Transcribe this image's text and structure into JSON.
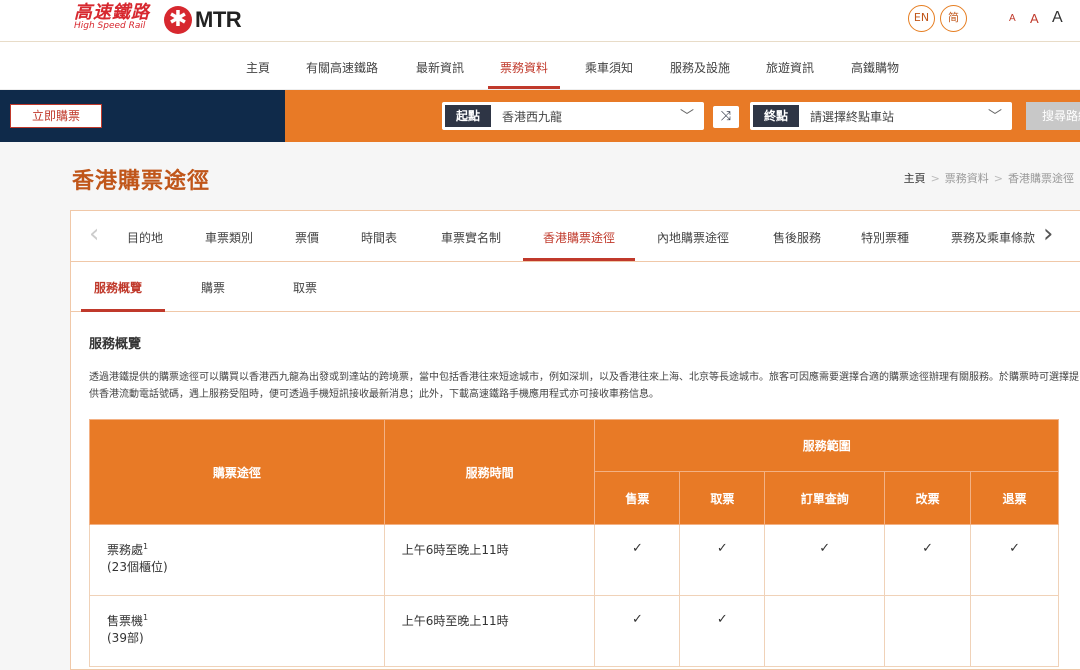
{
  "header": {
    "brand_zh": "高速鐵路",
    "brand_en": "High Speed Rail",
    "mtr_label": "MTR",
    "lang_en": "EN",
    "lang_sc": "简",
    "font_small": "A",
    "font_medium": "A",
    "font_large": "A"
  },
  "nav": {
    "items": [
      "主頁",
      "有關高速鐵路",
      "最新資訊",
      "票務資料",
      "乘車須知",
      "服務及設施",
      "旅遊資訊",
      "高鐵購物"
    ],
    "active_index": 3
  },
  "booking": {
    "buy_label": "立即購票",
    "origin_tag": "起點",
    "origin_value": "香港西九龍",
    "dest_tag": "終點",
    "dest_placeholder": "請選擇終點車站",
    "search_label": "搜尋路線"
  },
  "page": {
    "title": "香港購票途徑",
    "breadcrumb": [
      "主頁",
      "票務資料",
      "香港購票途徑"
    ]
  },
  "tabs": {
    "items": [
      "目的地",
      "車票類別",
      "票價",
      "時間表",
      "車票實名制",
      "香港購票途徑",
      "內地購票途徑",
      "售後服務",
      "特別票種",
      "票務及乘車條款"
    ],
    "active_index": 5
  },
  "subtabs": {
    "items": [
      "服務概覽",
      "購票",
      "取票"
    ],
    "active_index": 0
  },
  "overview": {
    "title": "服務概覽",
    "description": "透過港鐵提供的購票途徑可以購買以香港西九龍為出發或到達站的跨境票，當中包括香港往來短途城市，例如深圳，以及香港往來上海、北京等長途城市。旅客可因應需要選擇合適的購票途徑辦理有關服務。於購票時可選擇提供香港流動電話號碼，遇上服務受阻時，便可透過手機短訊接收最新消息；此外，下載高速鐵路手機應用程式亦可接收車務信息。"
  },
  "table": {
    "col_channel": "購票途徑",
    "col_hours": "服務時間",
    "col_scope": "服務範圍",
    "scope_cols": [
      "售票",
      "取票",
      "訂單查詢",
      "改票",
      "退票"
    ],
    "check_mark": "✓",
    "rows": [
      {
        "name": "票務處",
        "sup": "1",
        "sub": "(23個櫃位)",
        "hours": "上午6時至晚上11時",
        "checks": [
          true,
          true,
          true,
          true,
          true
        ]
      },
      {
        "name": "售票機",
        "sup": "1",
        "sub": "(39部)",
        "hours": "上午6時至晚上11時",
        "checks": [
          true,
          true,
          false,
          false,
          false
        ]
      }
    ]
  },
  "colors": {
    "accent_orange": "#e87a26",
    "brand_red": "#c0392b",
    "navy": "#0f2a4a"
  },
  "icons": {
    "swap": "swap-icon",
    "chevron": "chevron-down-icon",
    "prev": "chevron-left-icon",
    "next": "chevron-right-icon"
  }
}
